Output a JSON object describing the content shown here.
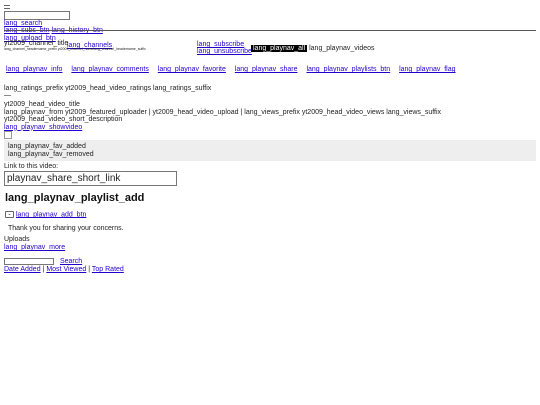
{
  "masthead": {
    "search_label": "lang_search",
    "subs_btn": "lang_subs_btn",
    "history_btn": "lang_history_btn",
    "upload_btn": "lang_upload_btn"
  },
  "channel": {
    "title": "yt2009_channel_title",
    "channels_link": "lang_channels",
    "headername": "lang_channel_headername_prefix yt2009_channel_namelang_channel_headername_suffix",
    "subscribe": "lang_subscribe",
    "unsubscribe": "lang_unsubscribe",
    "all_tab": "lang_playnav_all",
    "videos_tab": "lang_playnav_videos"
  },
  "playnav_tabs": [
    "lang_playnav_info",
    "lang_playnav_comments",
    "lang_playnav_favorite",
    "lang_playnav_share",
    "lang_playnav_playlists_btn",
    "lang_playnav_flag"
  ],
  "ratings": "lang_ratings_prefix yt2009_head_video_ratings lang_ratings_suffix",
  "video": {
    "title": "yt2009_head_video_title",
    "meta": "lang_playnav_from yt2009_featured_uploader | yt2009_head_video_upload | lang_views_prefix yt2009_head_video_views lang_views_suffix",
    "description": "yt2009_head_video_short_description",
    "show_video": "lang_playnav_showvideo"
  },
  "fav": {
    "added": "lang_playnav_fav_added",
    "removed": "lang_playnav_fav_removed"
  },
  "share": {
    "label": "Link to this video:",
    "value": "playnav_share_short_link"
  },
  "playlist": {
    "title": "lang_playnav_playlist_add",
    "add_btn": "lang_playnav_add_btn",
    "thanks": "Thank you for sharing your concerns."
  },
  "uploads": {
    "label": "Uploads",
    "more": "lang_playnav_more"
  },
  "search": {
    "button": "Search",
    "sort_date": "Date Added",
    "sort_viewed": "Most Viewed",
    "sort_rated": "Top Rated",
    "separator": "|"
  },
  "colors": {
    "link": "#2200cc",
    "fav_bg": "#eeeeee",
    "pill_bg": "#000000"
  }
}
